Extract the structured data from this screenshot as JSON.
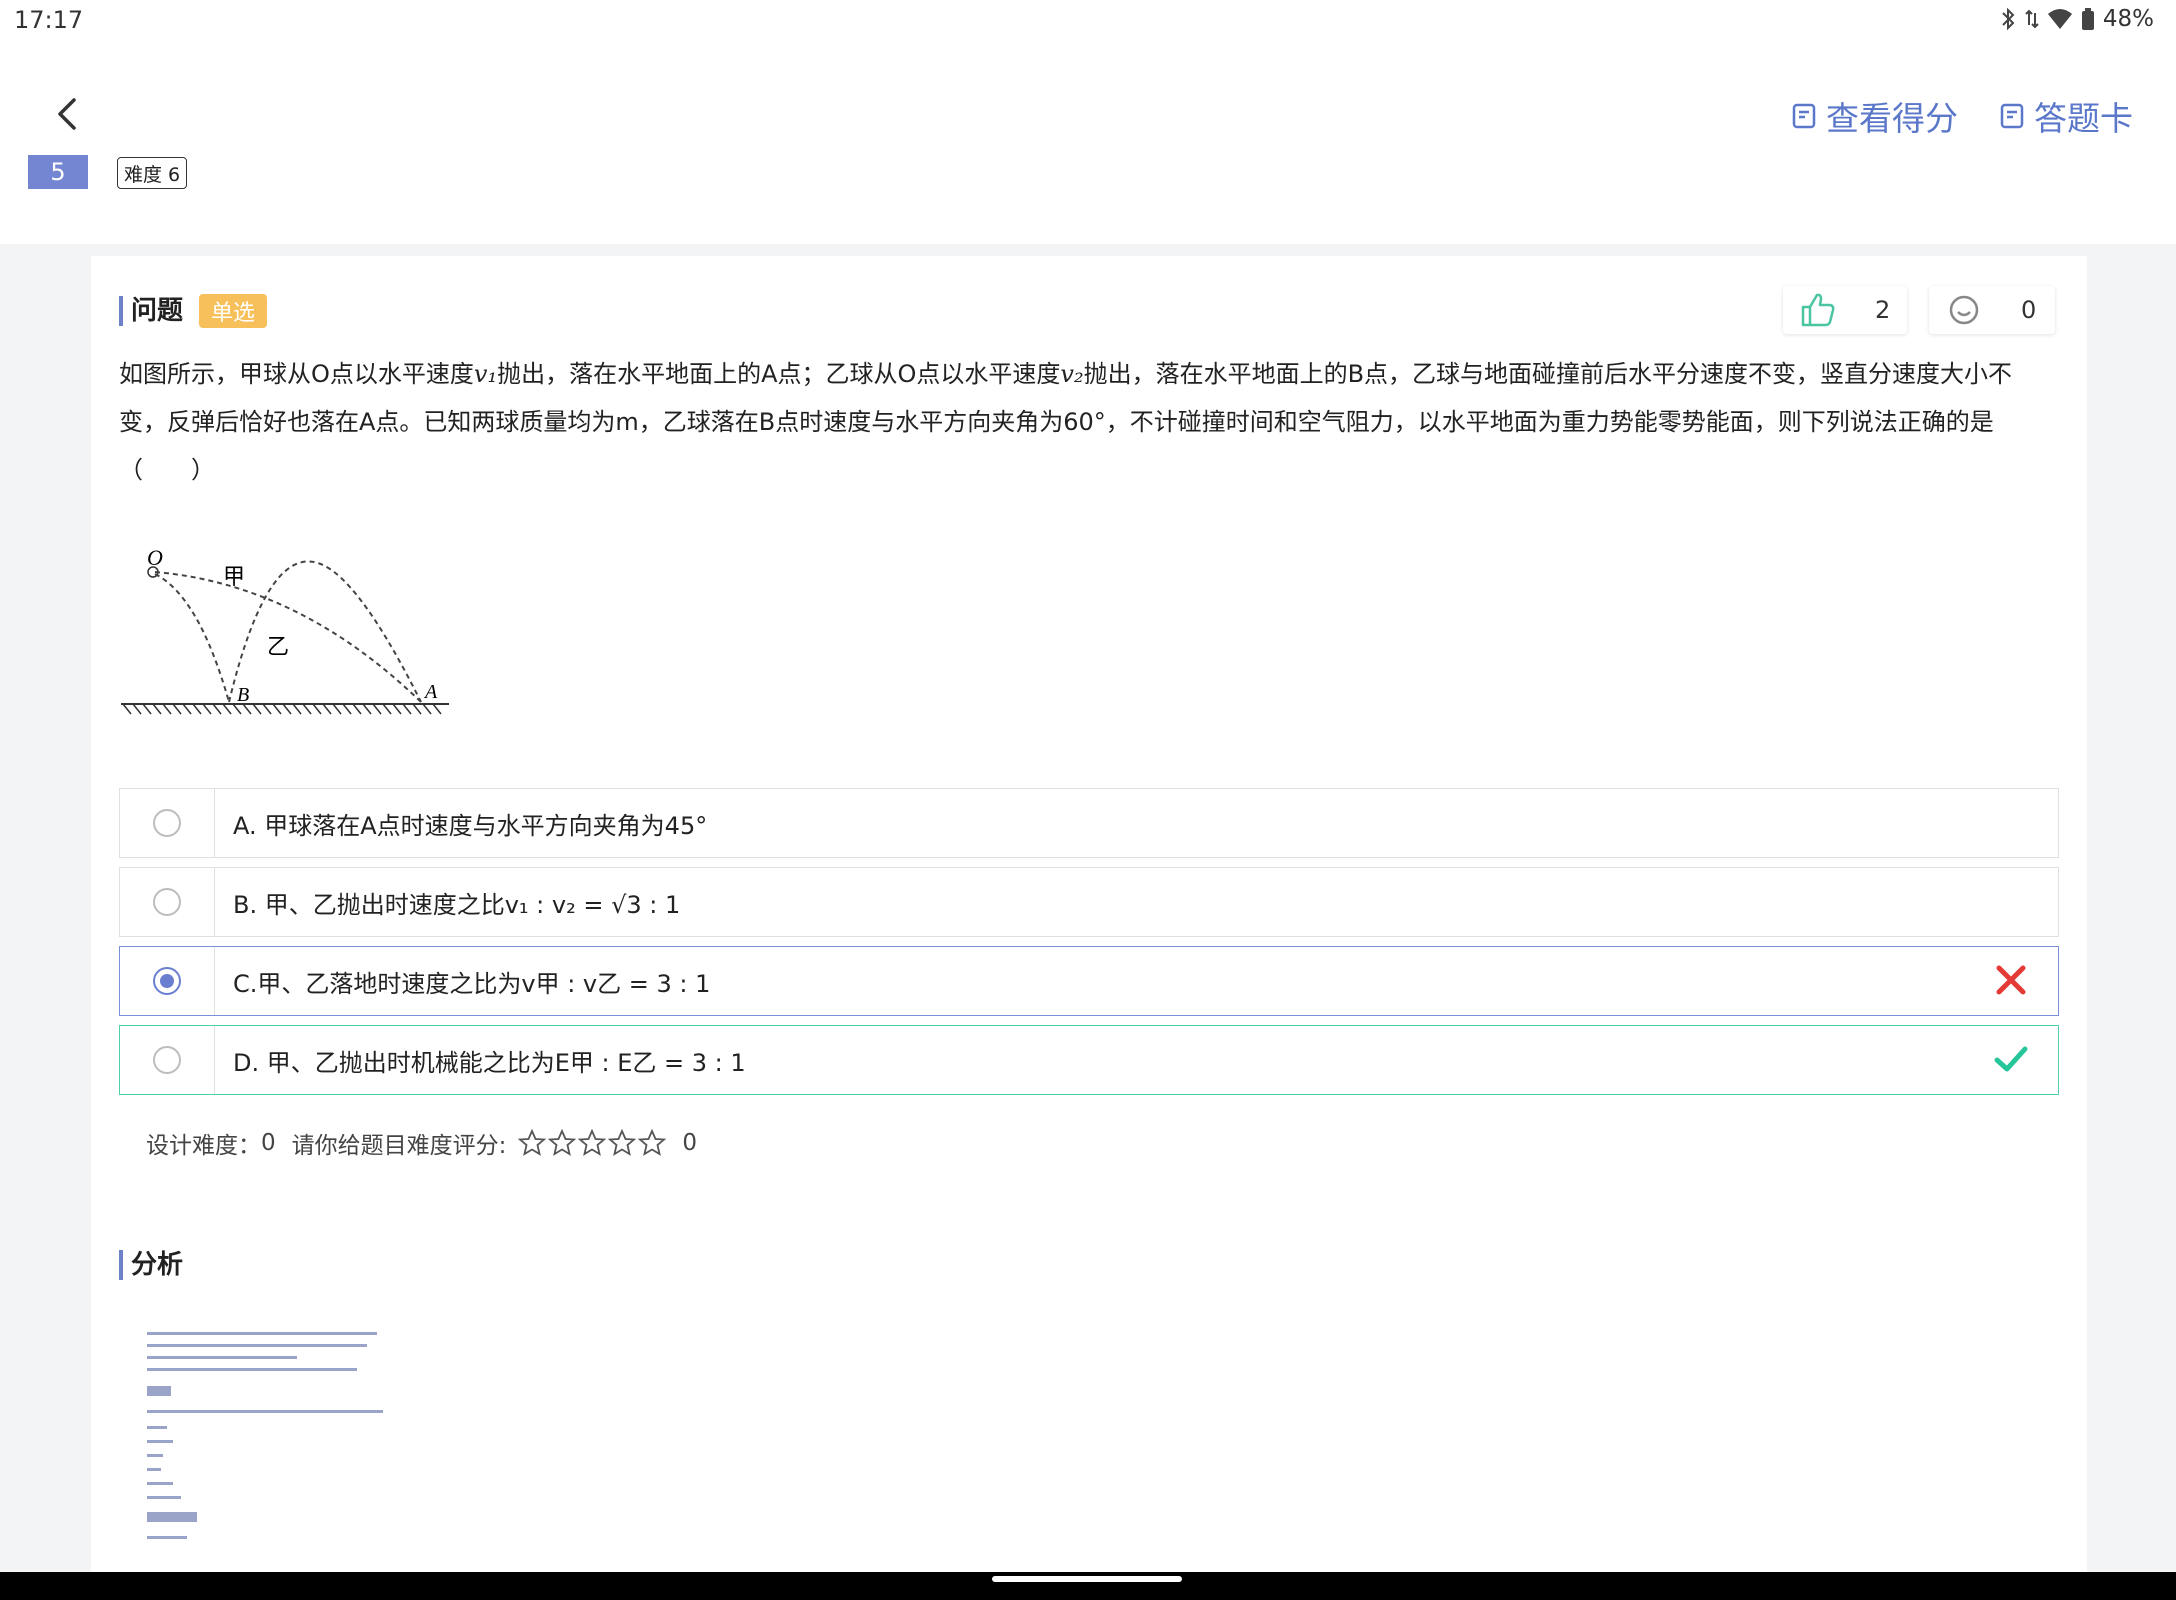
{
  "status": {
    "time": "17:17",
    "battery": "48%"
  },
  "header": {
    "view_score": "查看得分",
    "answer_card": "答题卡"
  },
  "question_number": "5",
  "difficulty_badge": "难度 6",
  "question": {
    "section_title": "问题",
    "type_tag": "单选",
    "likes": "2",
    "comments": "0",
    "text_part1": "如图所示，甲球从O点以水平速度",
    "v1": "v₁",
    "text_part2": "抛出，落在水平地面上的A点；乙球从O点以水平速度",
    "v2": "v₂",
    "text_part3": "抛出，落在水平地面上的B点，乙球与地面碰撞前后水平分速度不变，竖直分速度大小不变，反弹后恰好也落在A点。已知两球质量均为m，乙球落在B点时速度与水平方向夹角为60°，不计碰撞时间和空气阻力，以水平地面为重力势能零势能面，则下列说法正确的是（　　）",
    "figure_labels": {
      "o": "O",
      "jia": "甲",
      "yi": "乙",
      "b": "B",
      "a": "A"
    }
  },
  "options": [
    {
      "text": "A. 甲球落在A点时速度与水平方向夹角为45°",
      "state": "none"
    },
    {
      "text": "B. 甲、乙抛出时速度之比v₁ : v₂ = √3 : 1",
      "state": "none"
    },
    {
      "text": "C.甲、乙落地时速度之比为v甲 : v乙 = 3 : 1",
      "state": "selected-wrong"
    },
    {
      "text": "D. 甲、乙抛出时机械能之比为E甲 : E乙 = 3 : 1",
      "state": "correct"
    }
  ],
  "rating": {
    "design_label": "设计难度：",
    "design_value": "0",
    "prompt": "请你给题目难度评分:",
    "value": "0",
    "stars": 5
  },
  "analysis": {
    "section_title": "分析"
  },
  "colors": {
    "accent": "#6b7fd0",
    "tag": "#f7c05a",
    "wrong": "#e53935",
    "correct": "#26c59a"
  }
}
